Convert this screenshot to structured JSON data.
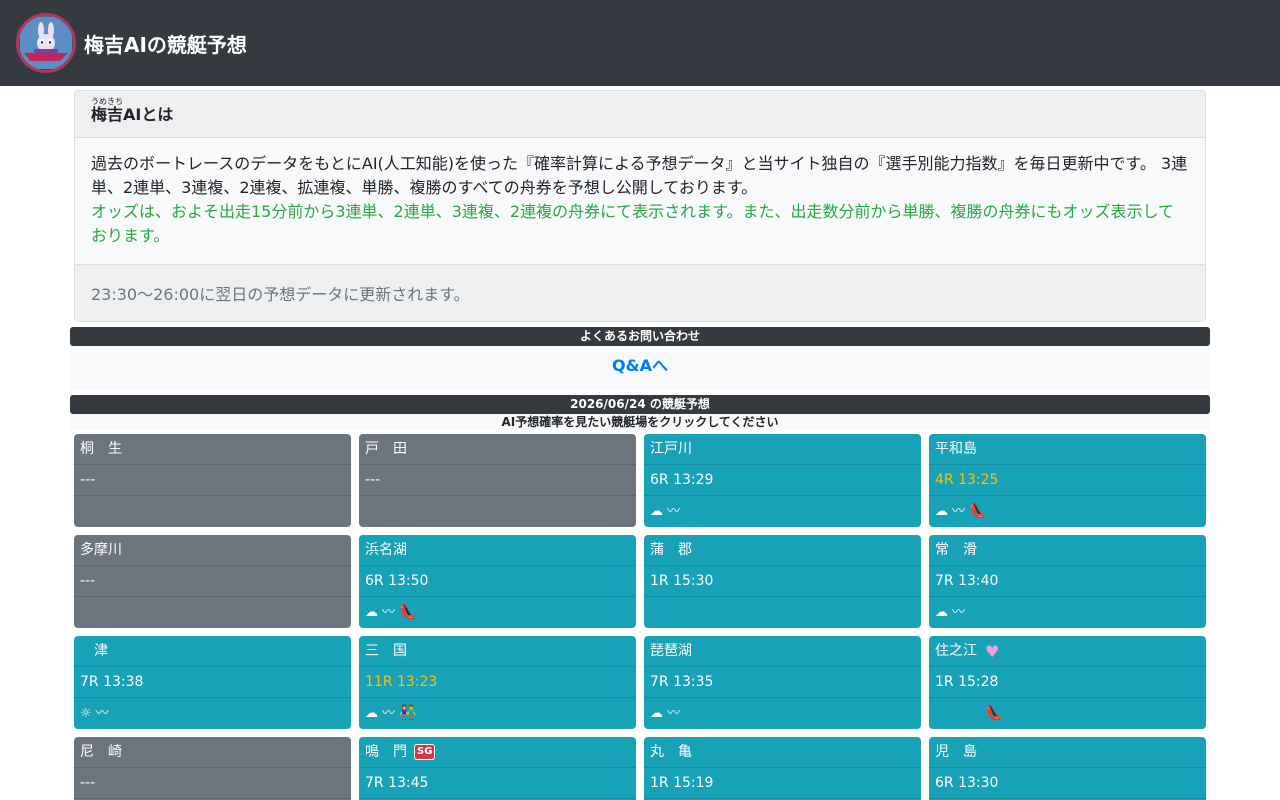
{
  "header": {
    "site_title": "梅吉AIの競艇予想"
  },
  "about": {
    "title_base": "梅吉",
    "title_ruby": "うめきち",
    "title_rest": "AIとは",
    "description": "過去のボートレースのデータをもとにAI(人工知能)を使った『確率計算による予想データ』と当サイト独自の『選手別能力指数』を毎日更新中です。 3連単、2連単、3連複、2連複、拡連複、単勝、複勝のすべての舟券を予想し公開しております。",
    "odds_note": "オッズは、およそ出走15分前から3連単、2連単、3連複、2連複の舟券にて表示されます。また、出走数分前から単勝、複勝の舟券にもオッズ表示しております。",
    "update_note": "23:30〜26:00に翌日の予想データに更新されます。"
  },
  "faq": {
    "title": "よくあるお問い合わせ",
    "link_label": "Q&Aへ"
  },
  "predictions": {
    "title": "2026/06/24 の競艇予想",
    "instruction": "AI予想確率を見たい競艇場をクリックしてください"
  },
  "venues": [
    {
      "name": "桐　生",
      "race": "---",
      "status": "closed"
    },
    {
      "name": "戸　田",
      "race": "---",
      "status": "closed"
    },
    {
      "name": "江戸川",
      "race": "6R 13:29",
      "status": "active"
    },
    {
      "name": "平和島",
      "race": "4R 13:25",
      "status": "active"
    },
    {
      "name": "多摩川",
      "race": "---",
      "status": "closed"
    },
    {
      "name": "浜名湖",
      "race": "6R 13:50",
      "status": "active"
    },
    {
      "name": "蒲　郡",
      "race": "1R 15:30",
      "status": "active"
    },
    {
      "name": "常　滑",
      "race": "7R 13:40",
      "status": "active"
    },
    {
      "name": "　津",
      "race": "7R 13:38",
      "status": "active"
    },
    {
      "name": "三　国",
      "race": "11R 13:23",
      "status": "active"
    },
    {
      "name": "琵琶湖",
      "race": "7R 13:35",
      "status": "active"
    },
    {
      "name": "住之江",
      "race": "1R 15:28",
      "status": "active"
    },
    {
      "name": "尼　崎",
      "race": "---",
      "status": "closed"
    },
    {
      "name": "鳴　門",
      "race": "7R 13:45",
      "status": "active",
      "badge": "SG"
    },
    {
      "name": "丸　亀",
      "race": "1R 15:19",
      "status": "active"
    },
    {
      "name": "児　島",
      "race": "6R 13:30",
      "status": "active"
    }
  ],
  "icons": {
    "cloudy": "☁",
    "sunny": "☼",
    "wind": "〰",
    "heel": "👠",
    "couple": "👫",
    "heart": "♥"
  },
  "colors": {
    "header_bg": "#343a40",
    "active": "#17a2b8",
    "closed": "#6c757d",
    "highlight": "#ffc107",
    "odds_text": "#28a745",
    "link": "#007bff",
    "sg_badge": "#dc3545"
  }
}
